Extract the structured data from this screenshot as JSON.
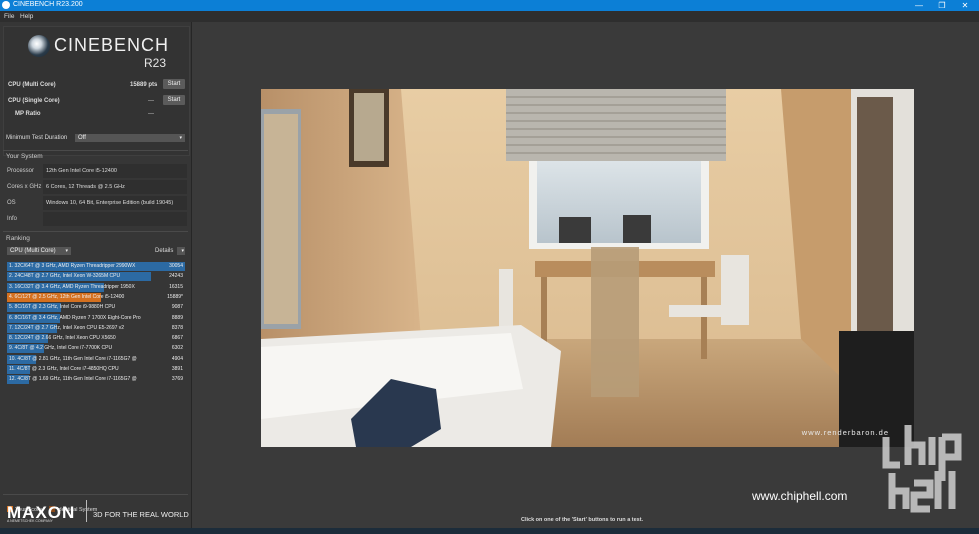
{
  "window": {
    "title": "CINEBENCH R23.200",
    "minimize": "—",
    "maximize": "❐",
    "close": "✕"
  },
  "menu": {
    "file": "File",
    "help": "Help"
  },
  "logo": {
    "name": "CINEBENCH",
    "version": "R23"
  },
  "tests": {
    "multi": {
      "label": "CPU (Multi Core)",
      "value": "15889 pts",
      "button": "Start"
    },
    "single": {
      "label": "CPU (Single Core)",
      "value": "---",
      "button": "Start"
    },
    "mp_ratio": {
      "label": "MP Ratio",
      "value": "---"
    }
  },
  "duration": {
    "label": "Minimum Test Duration",
    "value": "Off"
  },
  "system": {
    "title": "Your System",
    "rows": [
      {
        "label": "Processor",
        "value": "12th Gen Intel Core i5-12400"
      },
      {
        "label": "Cores x GHz",
        "value": "6 Cores, 12 Threads @ 2.5 GHz"
      },
      {
        "label": "OS",
        "value": "Windows 10, 64 Bit, Enterprise Edition (build 19045)"
      },
      {
        "label": "Info",
        "value": ""
      }
    ]
  },
  "ranking": {
    "title": "Ranking",
    "dropdown": "CPU (Multi Core)",
    "details": "Details",
    "items": [
      {
        "label": "1. 32C/64T @ 3 GHz, AMD Ryzen Threadripper 2990WX",
        "score": "30054",
        "fill": 1.0,
        "mine": false
      },
      {
        "label": "2. 24C/48T @ 2.7 GHz, Intel Xeon W-3265M CPU",
        "score": "24243",
        "fill": 0.807,
        "mine": false
      },
      {
        "label": "3. 16C/32T @ 3.4 GHz, AMD Ryzen Threadripper 1950X",
        "score": "16315",
        "fill": 0.543,
        "mine": false
      },
      {
        "label": "4. 6C/12T @ 2.5 GHz, 12th Gen Intel Core i5-12400",
        "score": "15889*",
        "fill": 0.529,
        "mine": true
      },
      {
        "label": "5. 8C/16T @ 2.3 GHz, Intel Core i9-9880H CPU",
        "score": "9087",
        "fill": 0.302,
        "mine": false
      },
      {
        "label": "6. 8C/16T @ 3.4 GHz, AMD Ryzen 7 1700X Eight-Core Pro",
        "score": "8889",
        "fill": 0.296,
        "mine": false
      },
      {
        "label": "7. 12C/24T @ 2.7 GHz, Intel Xeon CPU E5-2697 v2",
        "score": "8378",
        "fill": 0.279,
        "mine": false
      },
      {
        "label": "8. 12C/24T @ 2.66 GHz, Intel Xeon CPU X5650",
        "score": "6867",
        "fill": 0.228,
        "mine": false
      },
      {
        "label": "9. 4C/8T @ 4.2 GHz, Intel Core i7-7700K CPU",
        "score": "6302",
        "fill": 0.21,
        "mine": false
      },
      {
        "label": "10. 4C/8T @ 2.81 GHz, 11th Gen Intel Core i7-1165G7 @",
        "score": "4904",
        "fill": 0.163,
        "mine": false
      },
      {
        "label": "11. 4C/8T @ 2.3 GHz, Intel Core i7-4850HQ CPU",
        "score": "3891",
        "fill": 0.129,
        "mine": false
      },
      {
        "label": "12. 4C/8T @ 1.69 GHz, 11th Gen Intel Core i7-1165G7 @",
        "score": "3769",
        "fill": 0.125,
        "mine": false
      }
    ]
  },
  "legend": {
    "your_score": "Your Score",
    "identical": "Identical System",
    "your_color": "#d4701f",
    "identical_color": "#8a4a1a"
  },
  "branding": {
    "maxon": "MAXON",
    "maxon_sub": "A NEMETSCHEK COMPANY",
    "tagline": "3D FOR THE REAL WORLD"
  },
  "render": {
    "watermark": "www.renderbaron.de"
  },
  "status": "Click on one of the 'Start' buttons to run a test.",
  "overlay": {
    "site": "www.chiphell.com"
  }
}
